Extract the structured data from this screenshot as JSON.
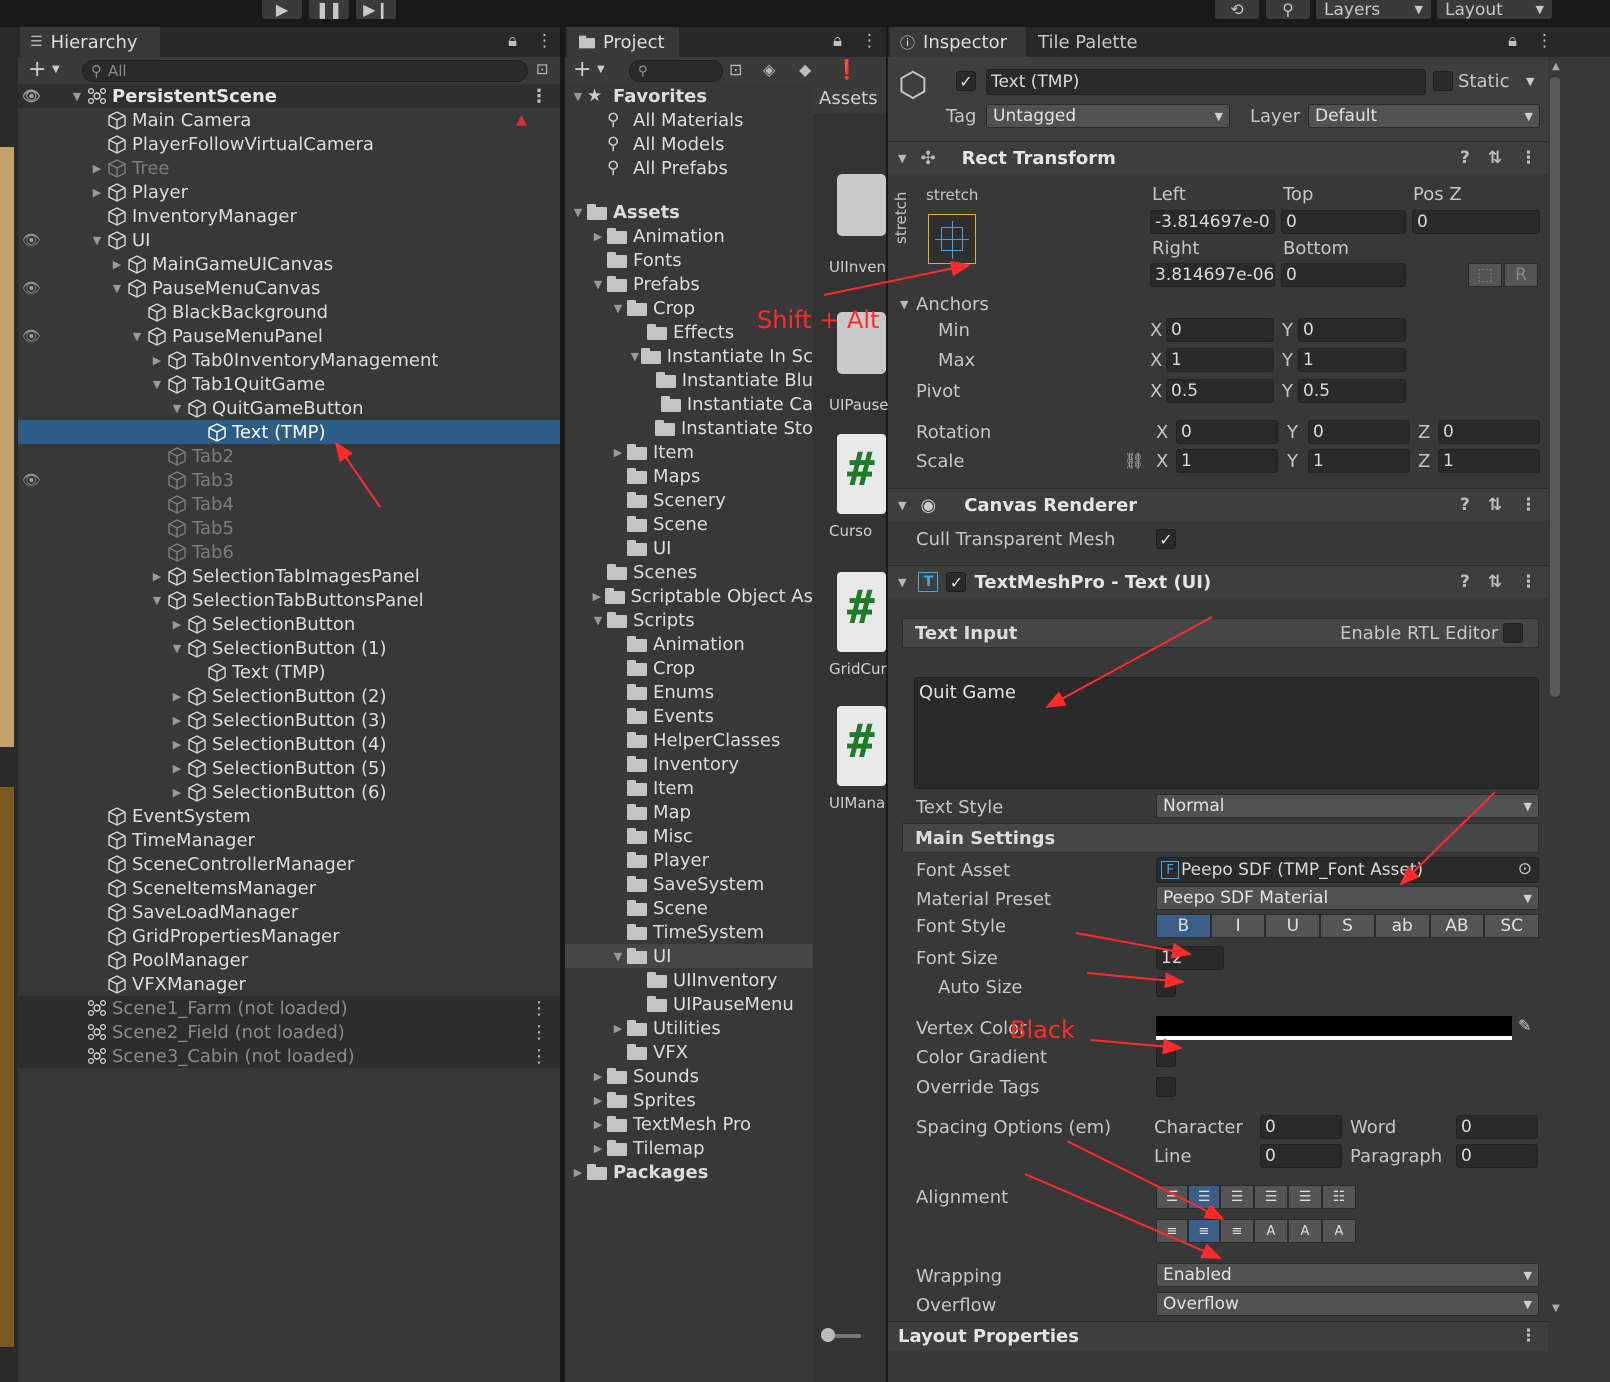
{
  "toolbar": {
    "layers": "Layers",
    "layout": "Layout"
  },
  "hierarchy": {
    "tab": "Hierarchy",
    "search_placeholder": "All",
    "rows": [
      {
        "label": "PersistentScene"
      },
      {
        "label": "Main Camera"
      },
      {
        "label": "PlayerFollowVirtualCamera"
      },
      {
        "label": "Tree"
      },
      {
        "label": "Player"
      },
      {
        "label": "InventoryManager"
      },
      {
        "label": "UI"
      },
      {
        "label": "MainGameUICanvas"
      },
      {
        "label": "PauseMenuCanvas"
      },
      {
        "label": "BlackBackground"
      },
      {
        "label": "PauseMenuPanel"
      },
      {
        "label": "Tab0InventoryManagement"
      },
      {
        "label": "Tab1QuitGame"
      },
      {
        "label": "QuitGameButton"
      },
      {
        "label": "Text (TMP)"
      },
      {
        "label": "Tab2"
      },
      {
        "label": "Tab3"
      },
      {
        "label": "Tab4"
      },
      {
        "label": "Tab5"
      },
      {
        "label": "Tab6"
      },
      {
        "label": "SelectionTabImagesPanel"
      },
      {
        "label": "SelectionTabButtonsPanel"
      },
      {
        "label": "SelectionButton"
      },
      {
        "label": "SelectionButton (1)"
      },
      {
        "label": "Text (TMP)"
      },
      {
        "label": "SelectionButton (2)"
      },
      {
        "label": "SelectionButton (3)"
      },
      {
        "label": "SelectionButton (4)"
      },
      {
        "label": "SelectionButton (5)"
      },
      {
        "label": "SelectionButton (6)"
      },
      {
        "label": "EventSystem"
      },
      {
        "label": "TimeManager"
      },
      {
        "label": "SceneControllerManager"
      },
      {
        "label": "SceneItemsManager"
      },
      {
        "label": "SaveLoadManager"
      },
      {
        "label": "GridPropertiesManager"
      },
      {
        "label": "PoolManager"
      },
      {
        "label": "VFXManager"
      },
      {
        "label": "Scene1_Farm (not loaded)"
      },
      {
        "label": "Scene2_Field (not loaded)"
      },
      {
        "label": "Scene3_Cabin (not loaded)"
      }
    ]
  },
  "project": {
    "tab": "Project",
    "assets_header": "Assets",
    "rows": [
      {
        "label": "Favorites"
      },
      {
        "label": "All Materials"
      },
      {
        "label": "All Models"
      },
      {
        "label": "All Prefabs"
      },
      {
        "label": "Assets"
      },
      {
        "label": "Animation"
      },
      {
        "label": "Fonts"
      },
      {
        "label": "Prefabs"
      },
      {
        "label": "Crop"
      },
      {
        "label": "Effects"
      },
      {
        "label": "Instantiate In Sc"
      },
      {
        "label": "Instantiate Blu"
      },
      {
        "label": "Instantiate Ca"
      },
      {
        "label": "Instantiate Sto"
      },
      {
        "label": "Item"
      },
      {
        "label": "Maps"
      },
      {
        "label": "Scenery"
      },
      {
        "label": "Scene"
      },
      {
        "label": "UI"
      },
      {
        "label": "Scenes"
      },
      {
        "label": "Scriptable Object As"
      },
      {
        "label": "Scripts"
      },
      {
        "label": "Animation"
      },
      {
        "label": "Crop"
      },
      {
        "label": "Enums"
      },
      {
        "label": "Events"
      },
      {
        "label": "HelperClasses"
      },
      {
        "label": "Inventory"
      },
      {
        "label": "Item"
      },
      {
        "label": "Map"
      },
      {
        "label": "Misc"
      },
      {
        "label": "Player"
      },
      {
        "label": "SaveSystem"
      },
      {
        "label": "Scene"
      },
      {
        "label": "TimeSystem"
      },
      {
        "label": "UI"
      },
      {
        "label": "UIInventory"
      },
      {
        "label": "UIPauseMenu"
      },
      {
        "label": "Utilities"
      },
      {
        "label": "VFX"
      },
      {
        "label": "Sounds"
      },
      {
        "label": "Sprites"
      },
      {
        "label": "TextMesh Pro"
      },
      {
        "label": "Tilemap"
      },
      {
        "label": "Packages"
      }
    ],
    "thumbs": [
      "UIInven",
      "UIPause",
      "Curso",
      "GridCur",
      "UIMana"
    ]
  },
  "inspector": {
    "tab": "Inspector",
    "tab2": "Tile Palette",
    "object_name": "Text (TMP)",
    "static_label": "Static",
    "tag_label": "Tag",
    "tag_value": "Untagged",
    "layer_label": "Layer",
    "layer_value": "Default",
    "rect": {
      "title": "Rect Transform",
      "stretch": "stretch",
      "left_label": "Left",
      "left": "-3.814697e-0",
      "top_label": "Top",
      "top": "0",
      "posz_label": "Pos Z",
      "posz": "0",
      "right_label": "Right",
      "right": "3.814697e-06",
      "bottom_label": "Bottom",
      "bottom": "0",
      "r_button": "R",
      "anchors": "Anchors",
      "min": "Min",
      "max": "Max",
      "pivot": "Pivot",
      "min_x": "0",
      "min_y": "0",
      "max_x": "1",
      "max_y": "1",
      "pivot_x": "0.5",
      "pivot_y": "0.5",
      "rotation": "Rotation",
      "scale": "Scale",
      "rot_x": "0",
      "rot_y": "0",
      "rot_z": "0",
      "scale_x": "1",
      "scale_y": "1",
      "scale_z": "1",
      "x": "X",
      "y": "Y",
      "z": "Z"
    },
    "canvas_renderer": {
      "title": "Canvas Renderer",
      "cull": "Cull Transparent Mesh"
    },
    "tmp": {
      "title": "TextMeshPro - Text (UI)",
      "text_input": "Text Input",
      "rtl": "Enable RTL Editor",
      "text": "Quit Game",
      "text_style_label": "Text Style",
      "text_style": "Normal",
      "main_settings": "Main Settings",
      "font_asset_label": "Font Asset",
      "font_asset": "Peepo SDF (TMP_Font Asset)",
      "material_label": "Material Preset",
      "material": "Peepo SDF Material",
      "font_style_label": "Font Style",
      "style_buttons": [
        "B",
        "I",
        "U",
        "S",
        "ab",
        "AB",
        "SC"
      ],
      "font_size_label": "Font Size",
      "font_size": "12",
      "auto_size": "Auto Size",
      "vertex_color_label": "Vertex Color",
      "vertex_color": "#000000",
      "color_gradient": "Color Gradient",
      "override_tags": "Override Tags",
      "spacing_label": "Spacing Options (em)",
      "character_label": "Character",
      "character": "0",
      "word_label": "Word",
      "word": "0",
      "line_label": "Line",
      "line": "0",
      "paragraph_label": "Paragraph",
      "paragraph": "0",
      "alignment_label": "Alignment",
      "wrapping_label": "Wrapping",
      "wrapping": "Enabled",
      "overflow_label": "Overflow",
      "overflow": "Overflow",
      "layout_properties": "Layout Properties"
    }
  },
  "annotations": {
    "shift_alt": "Shift + Alt",
    "black": "Black"
  },
  "colors": {
    "selection": "#2c5d87",
    "annotation": "#ff2b2b",
    "accent_on": "#3b5f86"
  }
}
